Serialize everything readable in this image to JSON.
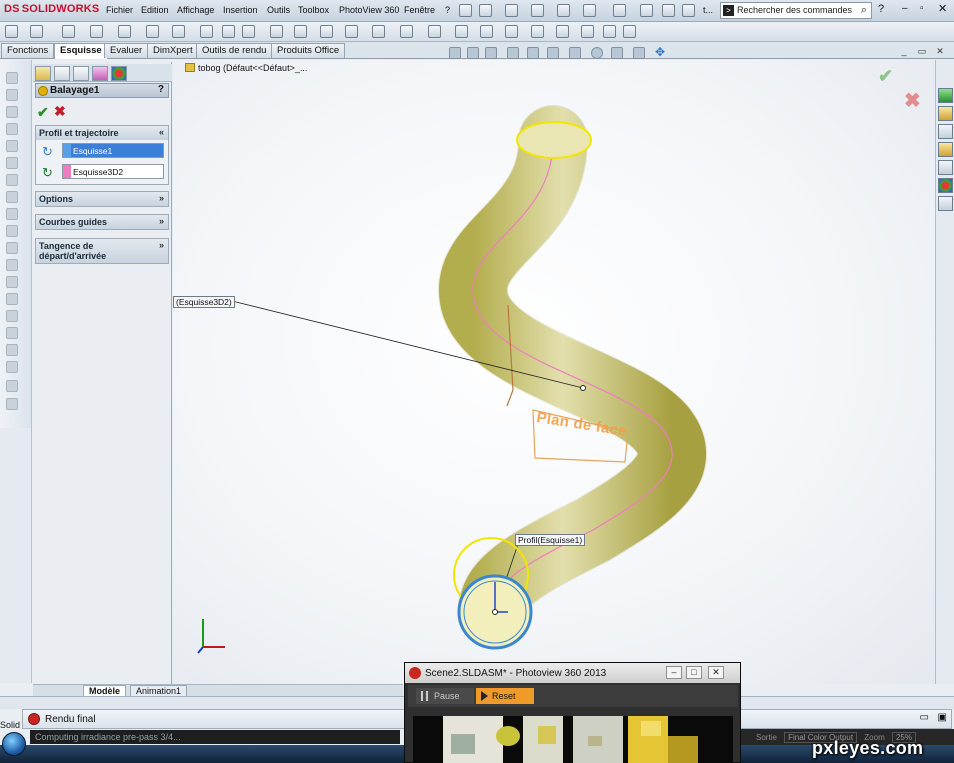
{
  "app": {
    "brand_prefix": "DS",
    "brand": "SOLIDWORKS"
  },
  "menu": {
    "items": [
      "Fichier",
      "Edition",
      "Affichage",
      "Insertion",
      "Outils",
      "Toolbox",
      "PhotoView 360",
      "Fenêtre",
      "?"
    ],
    "doc_short": "t...",
    "search_placeholder": "Rechercher des commandes",
    "help": "?"
  },
  "command_tabs": [
    {
      "label": "Fonctions",
      "active": false
    },
    {
      "label": "Esquisse",
      "active": true
    },
    {
      "label": "Evaluer",
      "active": false
    },
    {
      "label": "DimXpert",
      "active": false
    },
    {
      "label": "Outils de rendu",
      "active": false
    },
    {
      "label": "Produits Office",
      "active": false
    }
  ],
  "property_manager": {
    "title": "Balayage1",
    "help": "?",
    "ok": "✔",
    "cancel": "✖",
    "groups": {
      "profile": "Profil et trajectoire",
      "options": "Options",
      "guides": "Courbes guides",
      "tangency_line1": "Tangence de",
      "tangency_line2": "départ/d'arrivée"
    },
    "chevron": "»",
    "profile_value": "Esquisse1",
    "path_value": "Esquisse3D2",
    "profile_swatch": "#5b9ee8",
    "path_swatch": "#f07cc0"
  },
  "bottom_tabs": [
    {
      "label": "Modèle",
      "active": true
    },
    {
      "label": "Animation1",
      "active": false
    }
  ],
  "viewport": {
    "tree_label": "tobog  (Défaut<<Défaut>_...",
    "callout_path": "(Esquisse3D2)",
    "callout_profile": "Profil(Esquisse1)",
    "plane_label": "Plan de face",
    "ok": "✔",
    "cancel": "✖",
    "tube_color": "#dcd67a",
    "profile_circle_color": "#3a86d0",
    "plane_color": "#e8a45a"
  },
  "render_panel": {
    "title": "Rendu final",
    "progress": "Computing irradiance pre-pass 3/4...",
    "output_label": "Sortie",
    "output_value": "Final Color Output",
    "zoom_label": "Zoom",
    "zoom_value": "25%"
  },
  "photoview": {
    "title": "Scene2.SLDASM* - Photoview 360 2013",
    "pause": "Pause",
    "reset": "Reset",
    "accent": "#f09a2a"
  },
  "statusbar": {
    "left": "Solid"
  },
  "watermark": "pxleyes.com"
}
